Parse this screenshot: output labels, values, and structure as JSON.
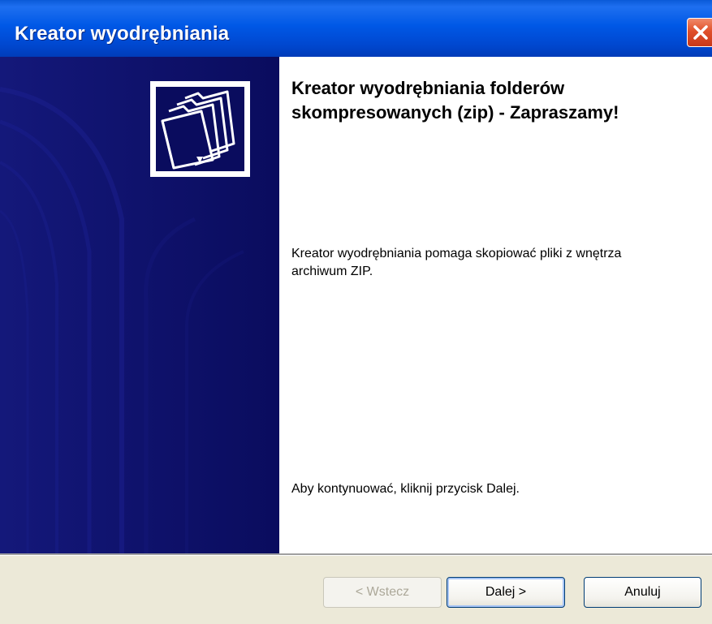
{
  "window": {
    "title": "Kreator wyodrębniania"
  },
  "sidebar": {
    "icon": "zip-folders-icon"
  },
  "content": {
    "heading": "Kreator wyodrębniania folderów skompresowanych (zip) - Zapraszamy!",
    "description": "Kreator wyodrębniania pomaga skopiować pliki z wnętrza archiwum ZIP.",
    "hint": "Aby kontynuować, kliknij przycisk Dalej."
  },
  "buttons": {
    "back": "< Wstecz",
    "next": "Dalej >",
    "cancel": "Anuluj"
  },
  "colors": {
    "titlebar": "#0058e6",
    "sidebar": "#0a0c5e",
    "footer": "#ece9d8",
    "close": "#e0502a"
  }
}
